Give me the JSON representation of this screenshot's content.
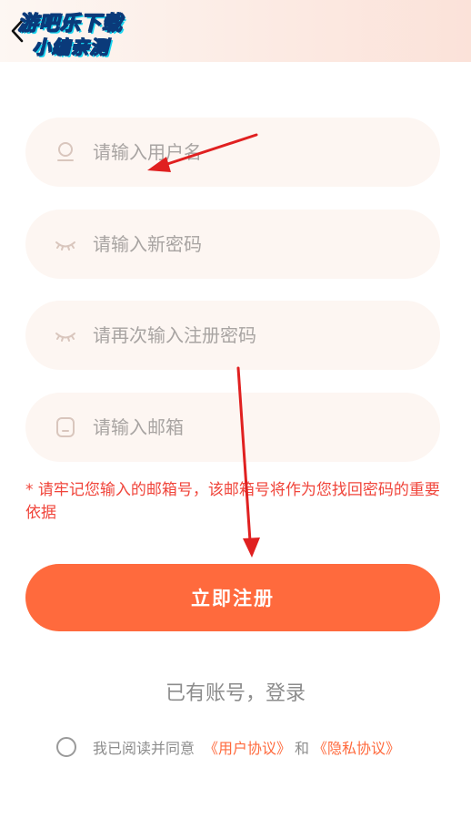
{
  "header": {
    "watermark_line1": "游吧乐下载",
    "watermark_line2": "小编亲测"
  },
  "form": {
    "username_placeholder": "请输入用户名",
    "password_placeholder": "请输入新密码",
    "confirm_password_placeholder": "请再次输入注册密码",
    "email_placeholder": "请输入邮箱"
  },
  "hint": "* 请牢记您输入的邮箱号，该邮箱号将作为您找回密码的重要依据",
  "register_label": "立即注册",
  "login_link": "已有账号，登录",
  "agreement": {
    "prefix": "我已阅读并同意",
    "user_agreement": "《用户协议》",
    "and": "和",
    "privacy_policy": "《隐私协议》"
  },
  "colors": {
    "accent": "#ff6a3d",
    "hint": "#f0453b",
    "field_bg": "#fdf6f2",
    "annotation_arrow": "#e02020"
  }
}
